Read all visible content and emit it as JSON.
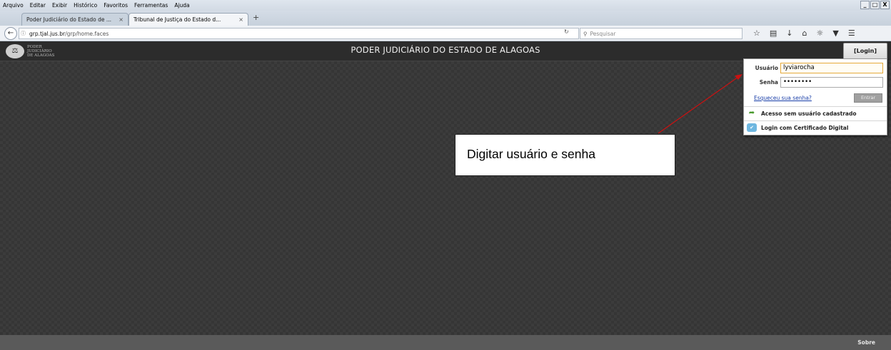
{
  "browser": {
    "menu": [
      {
        "label": "Arquivo"
      },
      {
        "label": "Editar"
      },
      {
        "label": "Exibir"
      },
      {
        "label": "Histórico"
      },
      {
        "label": "Favoritos"
      },
      {
        "label": "Ferramentas"
      },
      {
        "label": "Ajuda"
      }
    ],
    "window_controls": [
      "_",
      "□",
      "X"
    ],
    "tabs": [
      {
        "title": "Poder Judiciário do Estado de ...",
        "active": false
      },
      {
        "title": "Tribunal de Justiça do Estado d...",
        "active": true
      }
    ],
    "tab_close": "×",
    "new_tab": "+",
    "url": {
      "host": "grp.tjal.jus.br",
      "path": "/grp/home.faces"
    },
    "search_placeholder": "Pesquisar"
  },
  "app": {
    "logo_text": [
      "PODER",
      "JUDICIÁRIO",
      "DE ALAGOAS"
    ],
    "title": "PODER JUDICIÁRIO DO ESTADO DE ALAGOAS",
    "login_button": "[Login]",
    "footer_link": "Sobre"
  },
  "login_panel": {
    "username_label": "Usuário",
    "username_value": "lyviarocha",
    "password_label": "Senha",
    "password_value": "••••••••",
    "forgot_link": "Esqueceu sua senha?",
    "submit_button": "Entrar",
    "option_no_user": "Acesso sem usuário cadastrado",
    "option_certificate": "Login com Certificado Digital"
  },
  "annotation": {
    "text": "Digitar usuário e senha",
    "arrow_color": "#cc1111"
  }
}
